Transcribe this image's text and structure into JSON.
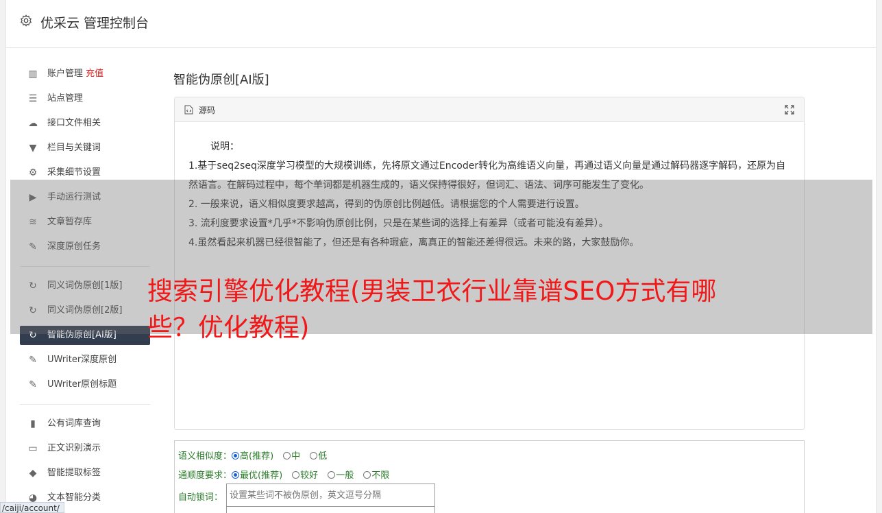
{
  "header": {
    "title": "优采云 管理控制台"
  },
  "sidebar": {
    "items": [
      {
        "label": "账户管理",
        "extra": "充值",
        "icon": "bar-chart-icon"
      },
      {
        "label": "站点管理",
        "icon": "list-icon"
      },
      {
        "label": "接口文件相关",
        "icon": "cloud-upload-icon"
      },
      {
        "label": "栏目与关键词",
        "icon": "filter-icon"
      },
      {
        "label": "采集细节设置",
        "icon": "gears-icon"
      },
      {
        "label": "手动运行测试",
        "icon": "play-icon"
      },
      {
        "label": "文章暂存库",
        "icon": "database-icon"
      },
      {
        "label": "深度原创任务",
        "icon": "edit-icon"
      },
      {
        "label": "同义词伪原创[1版]",
        "icon": "refresh-icon"
      },
      {
        "label": "同义词伪原创[2版]",
        "icon": "refresh-icon"
      },
      {
        "label": "智能伪原创[AI版]",
        "icon": "refresh-icon"
      },
      {
        "label": "UWriter深度原创",
        "icon": "edit-icon"
      },
      {
        "label": "UWriter原创标题",
        "icon": "edit-icon"
      },
      {
        "label": "公有词库查询",
        "icon": "book-icon"
      },
      {
        "label": "正文识别演示",
        "icon": "monitor-icon"
      },
      {
        "label": "智能提取标签",
        "icon": "tag-icon"
      },
      {
        "label": "文本智能分类",
        "icon": "pie-chart-icon"
      }
    ]
  },
  "main": {
    "title": "智能伪原创[AI版]",
    "panel": {
      "label": "源码",
      "intro": "说明：",
      "lines": [
        "1.基于seq2seq深度学习模型的大规模训练，先将原文通过Encoder转化为高维语义向量，再通过语义向量是通过解码器逐字解码，还原为自然语言。在解码过程中，每个单词都是机器生成的，语义保持得很好，但词汇、语法、词序可能发生了变化。",
        "2. 一般来说，语义相似度要求越高，得到的伪原创比例越低。请根据您的个人需要进行设置。",
        "3. 流利度要求设置*几乎*不影响伪原创比例，只是在某些词的选择上有差异（或者可能没有差异）。",
        "4.虽然看起来机器已经很智能了，但还是有各种瑕疵，离真正的智能还差得很远。未来的路，大家鼓励你。"
      ]
    },
    "options": {
      "similarity": {
        "label": "语义相似度：",
        "choices": [
          "高(推荐)",
          "中",
          "低"
        ],
        "selected": "高(推荐)"
      },
      "fluency": {
        "label": "通顺度要求：",
        "choices": [
          "最优(推荐)",
          "较好",
          "一般",
          "不限"
        ],
        "selected": "最优(推荐)"
      },
      "lock": {
        "label": "自动锁词：",
        "placeholder": "设置某些词不被伪原创，英文逗号分隔"
      }
    }
  },
  "overlay": {
    "headline": "搜索引擎优化教程(男装卫衣行业靠谱SEO方式有哪些？优化教程)"
  },
  "statusbar": {
    "url": "/caiji/account/"
  }
}
